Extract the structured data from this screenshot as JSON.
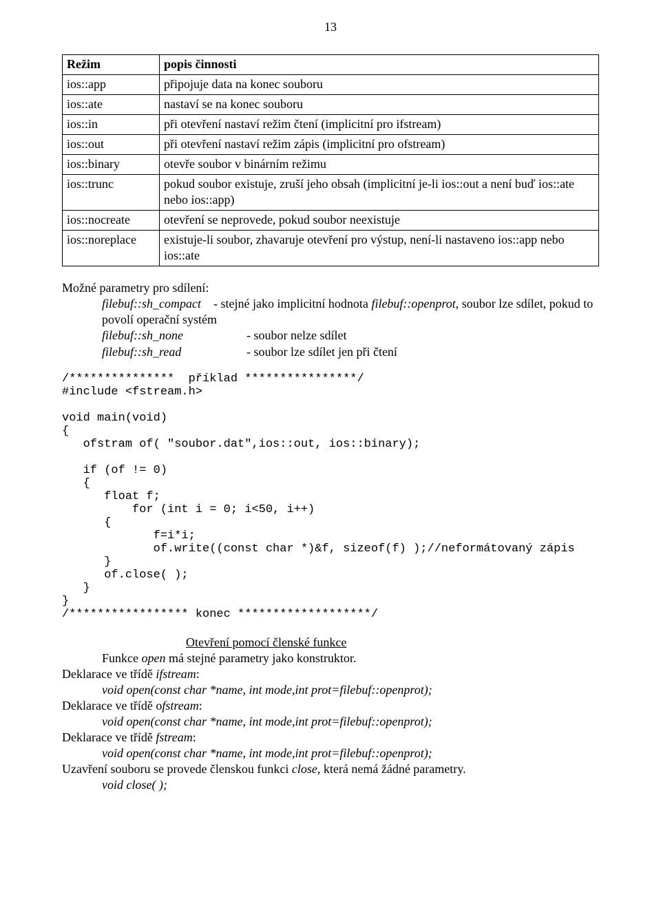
{
  "page_number": "13",
  "table": {
    "header_left": "Režim",
    "header_right": "popis činnosti",
    "rows": [
      {
        "l": "ios::app",
        "r": "připojuje data na konec souboru"
      },
      {
        "l": "ios::ate",
        "r": "nastaví se na konec souboru"
      },
      {
        "l": "ios::in",
        "r": "při otevření nastaví režim čtení (implicitní pro ifstream)"
      },
      {
        "l": "ios::out",
        "r": "při otevření nastaví režim zápis (implicitní pro ofstream)"
      },
      {
        "l": "ios::binary",
        "r": "otevře soubor v binárním režimu"
      },
      {
        "l": "ios::trunc",
        "r": "pokud soubor existuje, zruší jeho obsah (implicitní je-li ios::out a není buď ios::ate nebo ios::app)"
      },
      {
        "l": "ios::nocreate",
        "r": "otevření se neprovede, pokud soubor neexistuje"
      },
      {
        "l": "ios::noreplace",
        "r": "existuje-li soubor, zhavaruje otevření pro výstup, není-li nastaveno ios::app nebo ios::ate"
      }
    ]
  },
  "params": {
    "heading": "Možné parametry pro sdílení:",
    "compact_label": "filebuf::sh_compact",
    "compact_mid": "- stejné jako implicitní hodnota ",
    "compact_ital": "filebuf::openprot",
    "compact_tail": ", soubor lze sdílet, pokud to povolí operační systém",
    "none_label": "filebuf::sh_none",
    "none_desc": "- soubor nelze sdílet",
    "read_label": "filebuf::sh_read",
    "read_desc": "- soubor lze sdílet jen při čtení"
  },
  "code": "/***************  příklad ****************/\n#include <fstream.h>\n\nvoid main(void)\n{\n   ofstram of( \"soubor.dat\",ios::out, ios::binary);\n\n   if (of != 0)\n   {\n      float f;\n          for (int i = 0; i<50, i++)\n      {\n             f=i*i;\n             of.write((const char *)&f, sizeof(f) );//neformátovaný zápis\n      }\n      of.close( );\n   }\n}\n/***************** konec *******************/",
  "open": {
    "title": "Otevření pomocí členské funkce",
    "line1_pre": "Funkce ",
    "line1_ital": "open",
    "line1_post": " má stejné parametry jako konstruktor.",
    "d1_pre": "Deklarace ve třídě ",
    "d1_ital": "ifstream",
    "d1_post": ":",
    "sig1": "void open(const char *name, int mode,int prot=filebuf::openprot);",
    "d2_pre": "Deklarace ve třídě o",
    "d2_ital": "fstream",
    "d2_post": ":",
    "sig2": "void open(const char *name, int mode,int prot=filebuf::openprot);",
    "d3_pre": "Deklarace ve třídě ",
    "d3_ital": "fstream",
    "d3_post": ":",
    "sig3": "void open(const char *name, int mode,int prot=filebuf::openprot);",
    "close_pre": "Uzavření souboru se provede členskou funkci ",
    "close_ital": "close",
    "close_post": ", která nemá žádné parametry.",
    "close_sig": "void close( );"
  }
}
